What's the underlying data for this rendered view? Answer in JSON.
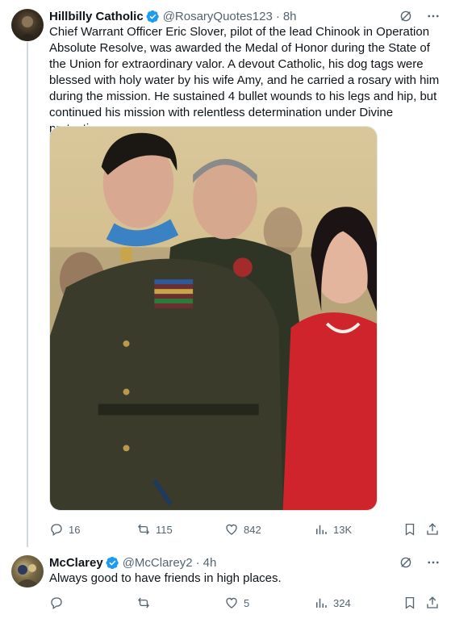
{
  "tweets": [
    {
      "author_name": "Hillbilly Catholic",
      "handle": "@RosaryQuotes123",
      "time": "8h",
      "text": "Chief Warrant Officer Eric Slover, pilot of the lead Chinook in Operation Absolute Resolve, was awarded the Medal of Honor during the State of the Union for extraordinary valor. A devout Catholic, his dog tags were blessed with holy water by his wife Amy, and he carried a rosary with him during the mission. He sustained 4 bullet wounds to his legs and hip, but continued his mission with relentless determination under Divine protection",
      "stats": {
        "replies": "16",
        "reposts": "115",
        "likes": "842",
        "views": "13K"
      }
    },
    {
      "author_name": "McClarey",
      "handle": "@McClarey2",
      "time": "4h",
      "text": "Always good to have friends in high places.",
      "stats": {
        "replies": "",
        "reposts": "",
        "likes": "5",
        "views": "324"
      }
    }
  ],
  "colors": {
    "verified": "#1d9bf0",
    "muted": "#536471",
    "thread_line": "#cfd9de"
  },
  "icons": [
    "grok-icon",
    "more-icon",
    "reply-icon",
    "repost-icon",
    "like-icon",
    "views-icon",
    "bookmark-icon",
    "share-icon",
    "verified-badge-icon"
  ]
}
